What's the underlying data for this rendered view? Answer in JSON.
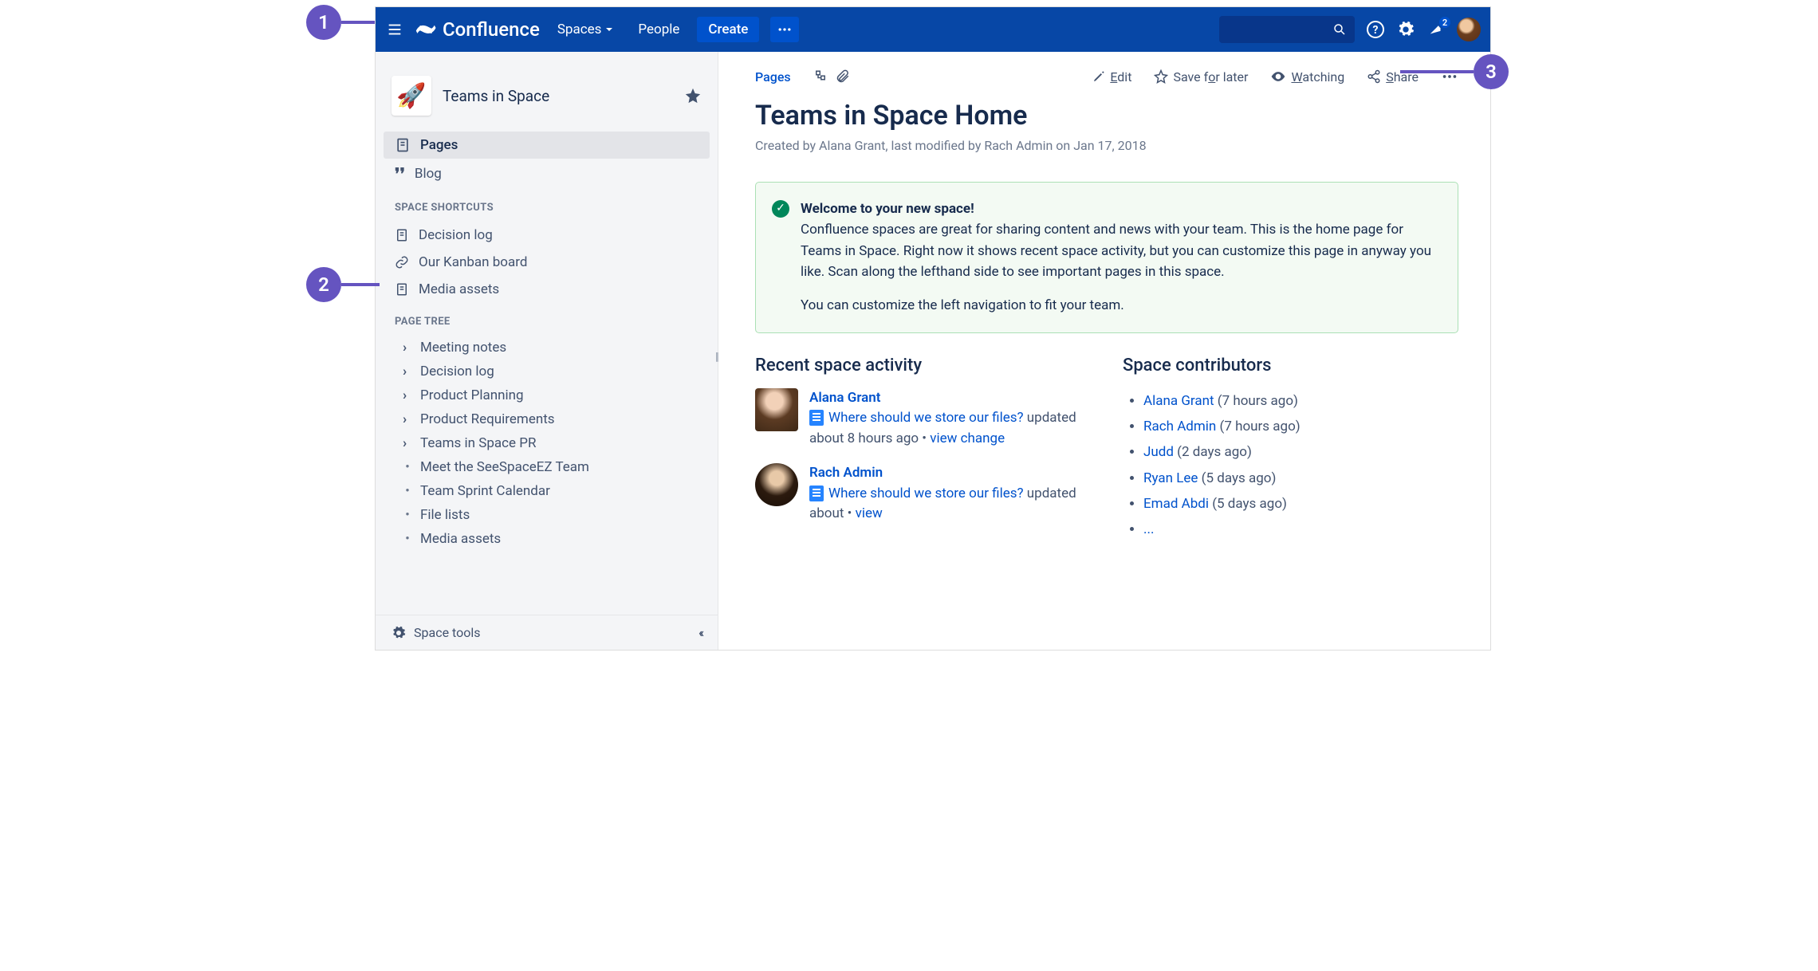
{
  "header": {
    "product": "Confluence",
    "spaces": "Spaces",
    "people": "People",
    "create": "Create",
    "notif_count": "2"
  },
  "sidebar": {
    "space_name": "Teams in Space",
    "nav": {
      "pages": "Pages",
      "blog": "Blog"
    },
    "shortcuts_heading": "SPACE SHORTCUTS",
    "shortcuts": [
      {
        "icon": "page",
        "label": "Decision log"
      },
      {
        "icon": "link",
        "label": "Our Kanban board"
      },
      {
        "icon": "page",
        "label": "Media assets"
      }
    ],
    "tree_heading": "PAGE TREE",
    "tree": [
      {
        "type": "caret",
        "label": "Meeting notes"
      },
      {
        "type": "caret",
        "label": "Decision log"
      },
      {
        "type": "caret",
        "label": "Product Planning"
      },
      {
        "type": "caret",
        "label": "Product Requirements"
      },
      {
        "type": "caret",
        "label": "Teams in Space PR"
      },
      {
        "type": "bullet",
        "label": "Meet the SeeSpaceEZ Team"
      },
      {
        "type": "bullet",
        "label": "Team Sprint Calendar"
      },
      {
        "type": "bullet",
        "label": "File lists"
      },
      {
        "type": "bullet",
        "label": "Media assets"
      }
    ],
    "footer": "Space tools"
  },
  "content": {
    "crumb": "Pages",
    "actions": {
      "edit_pre": "E",
      "edit_post": "dit",
      "save_pre": "Save f",
      "save_post": "r later",
      "save_ul": "o",
      "watch_pre": "W",
      "watch_post": "atching",
      "share_pre": "S",
      "share_post": "hare"
    },
    "title": "Teams in Space Home",
    "byline": "Created by Alana Grant, last modified by Rach Admin on Jan 17, 2018",
    "panel": {
      "heading": "Welcome to your new space!",
      "p1": "Confluence spaces are great for sharing content and news with your team. This is the home page for Teams in Space. Right now it shows recent space activity, but you can customize this page in anyway you like. Scan along the lefthand side to see important pages in this space.",
      "p2": "You can customize the left navigation to fit your team."
    },
    "recent_heading": "Recent space activity",
    "recent": [
      {
        "author": "Alana Grant",
        "page": "Where should we store our files?",
        "meta": "updated about 8 hours ago",
        "link2": "view change"
      },
      {
        "author": "Rach Admin",
        "page": "Where should we store our files?",
        "meta": "updated about",
        "link2": "view"
      }
    ],
    "contrib_heading": "Space contributors",
    "contributors": [
      {
        "name": "Alana Grant",
        "ago": "(7 hours ago)"
      },
      {
        "name": "Rach Admin",
        "ago": "(7 hours ago)"
      },
      {
        "name": "Judd",
        "ago": "(2 days ago)"
      },
      {
        "name": "Ryan Lee",
        "ago": "(5 days ago)"
      },
      {
        "name": "Emad Abdi",
        "ago": "(5 days ago)"
      }
    ],
    "contrib_more": "..."
  },
  "annotations": {
    "a1": "1",
    "a2": "2",
    "a3": "3"
  }
}
